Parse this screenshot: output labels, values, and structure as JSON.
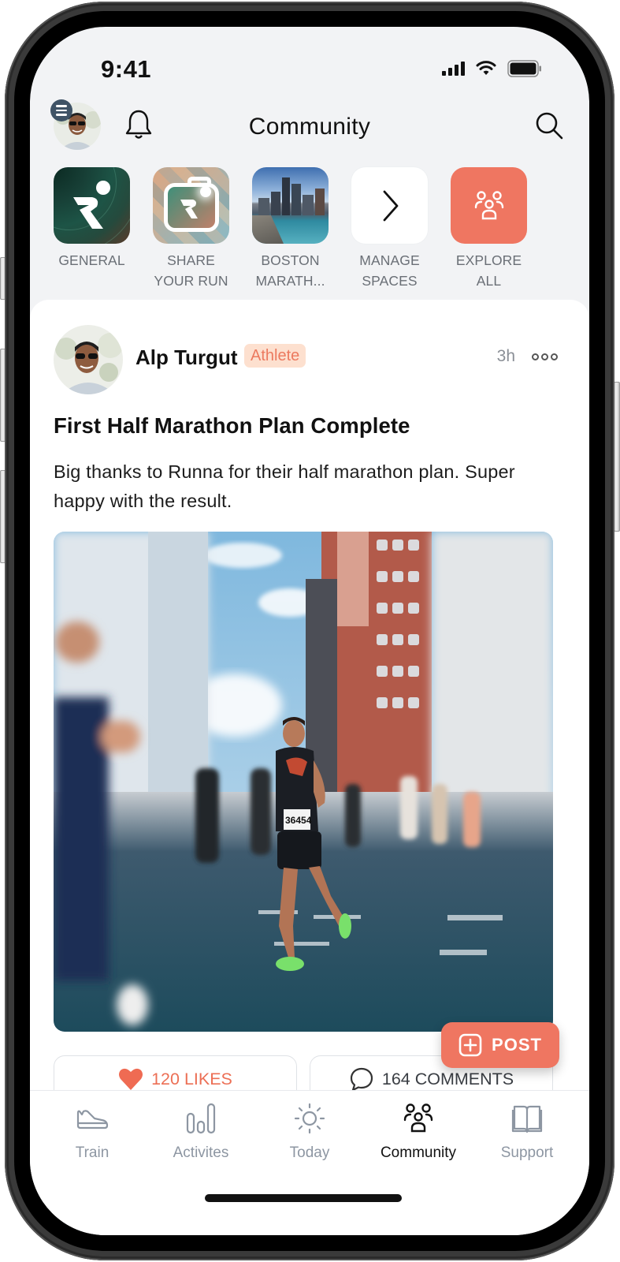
{
  "status_bar": {
    "time": "9:41",
    "icons": [
      "cellular-signal-icon",
      "wifi-icon",
      "battery-icon"
    ]
  },
  "header": {
    "title": "Community",
    "left_icons": [
      "profile-avatar",
      "menu-icon",
      "bell-icon"
    ],
    "right_icons": [
      "search-icon"
    ]
  },
  "spaces": [
    {
      "label": "GENERAL",
      "icon": "runna-logo-icon"
    },
    {
      "label": "SHARE\nYOUR RUN",
      "icon": "camera-icon"
    },
    {
      "label": "BOSTON\nMARATH...",
      "icon": "boston-skyline-image"
    },
    {
      "label": "MANAGE\nSPACES",
      "icon": "chevron-right-icon"
    },
    {
      "label": "EXPLORE\nALL",
      "icon": "group-icon"
    }
  ],
  "post": {
    "author": "Alp Turgut",
    "role_badge": "Athlete",
    "time_ago": "3h",
    "title": "First Half Marathon Plan Complete",
    "body": "Big thanks to Runna for their half marathon plan. Super happy with the result.",
    "image_description": "Marathon runners on a city street between tall buildings",
    "bib_number": "36454",
    "likes_label": "120 LIKES",
    "comments_label": "164 COMMENTS"
  },
  "fab": {
    "label": "POST",
    "icon": "plus-square-icon"
  },
  "tabbar": {
    "active": "Community",
    "items": [
      {
        "label": "Train",
        "icon": "shoe-icon"
      },
      {
        "label": "Activites",
        "icon": "bar-chart-icon"
      },
      {
        "label": "Today",
        "icon": "sun-icon"
      },
      {
        "label": "Community",
        "icon": "group-icon"
      },
      {
        "label": "Support",
        "icon": "book-icon"
      }
    ]
  },
  "colors": {
    "accent": "#ef7661",
    "badge_bg": "#fde0cf",
    "badge_text": "#ec7a5f",
    "screen_bg": "#f2f3f5",
    "tab_inactive": "#8d96a2",
    "menu_badge": "#3f5366"
  }
}
